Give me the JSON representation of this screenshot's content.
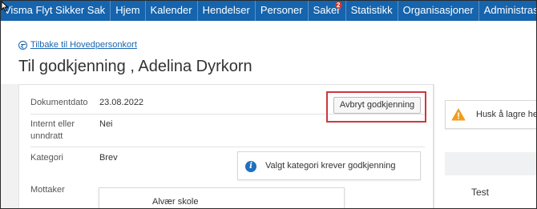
{
  "nav": {
    "items": [
      {
        "label": "Visma Flyt Sikker Sak"
      },
      {
        "label": "Hjem"
      },
      {
        "label": "Kalender"
      },
      {
        "label": "Hendelser"
      },
      {
        "label": "Personer"
      },
      {
        "label": "Saker",
        "badge": "2"
      },
      {
        "label": "Statistikk"
      },
      {
        "label": "Organisasjoner"
      },
      {
        "label": "Administrasjon"
      }
    ],
    "background_color": "#1564ad"
  },
  "back_link": {
    "label": "Tilbake til Hovedpersonkort",
    "icon": "arrow-left-circle-icon"
  },
  "page_title": "Til godkjenning , Adelina Dyrkorn",
  "fields": {
    "dokumentdato": {
      "label": "Dokumentdato",
      "value": "23.08.2022"
    },
    "internt": {
      "label": "Internt eller unndratt",
      "value": "Nei"
    },
    "kategori": {
      "label": "Kategori",
      "value": "Brev"
    },
    "mottaker": {
      "label": "Mottaker"
    }
  },
  "cancel_button": {
    "label": "Avbryt godkjenning",
    "highlight_color": "#d0383c"
  },
  "info_message": {
    "text": "Valgt kategori krever godkjenning",
    "icon": "info-icon"
  },
  "recipient": {
    "name": "Alvær skole"
  },
  "warning_message": {
    "text": "Husk å lagre hen",
    "icon": "warning-icon",
    "color": "#f29d1f"
  },
  "right_panel": {
    "test_label": "Test"
  }
}
